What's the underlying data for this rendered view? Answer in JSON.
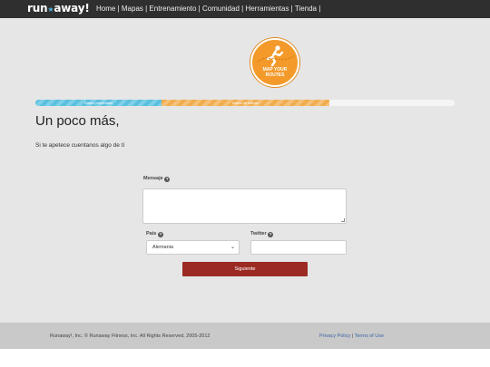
{
  "logo": {
    "pre": "run",
    "star": "★",
    "post": "away!"
  },
  "nav": [
    {
      "label": "Home",
      "sep": " | "
    },
    {
      "label": "Mapas",
      "sep": "  | "
    },
    {
      "label": "Entrenamiento",
      "sep": "  | "
    },
    {
      "label": "Comunidad",
      "sep": "  | "
    },
    {
      "label": "Herramientas",
      "sep": "  | "
    },
    {
      "label": "Tienda",
      "sep": "  | "
    }
  ],
  "badge": {
    "line1": "MAP YOUR",
    "line2": "ROUTES",
    "color": "#f39a2b"
  },
  "progress": {
    "step1": "Datos personales",
    "step2": "Datos de interes",
    "step1_color": "#5bc0de",
    "step2_color": "#f0ad4e"
  },
  "heading": "Un poco más,",
  "subtext": "Si te apetece cuentanos algo de tí",
  "form": {
    "message_label": "Mensaje",
    "country_label": "País",
    "country_value": "Alemania",
    "twitter_label": "Twitter",
    "submit_label": "Siguiente",
    "submit_color": "#9b2a22"
  },
  "footer": {
    "copyright": "Runaway!, Inc. © Runaway Fitness, Inc. All Rights Reserved, 2005-2012",
    "privacy": "Privacy Policy",
    "sep": " | ",
    "terms": "Terms of Use"
  }
}
